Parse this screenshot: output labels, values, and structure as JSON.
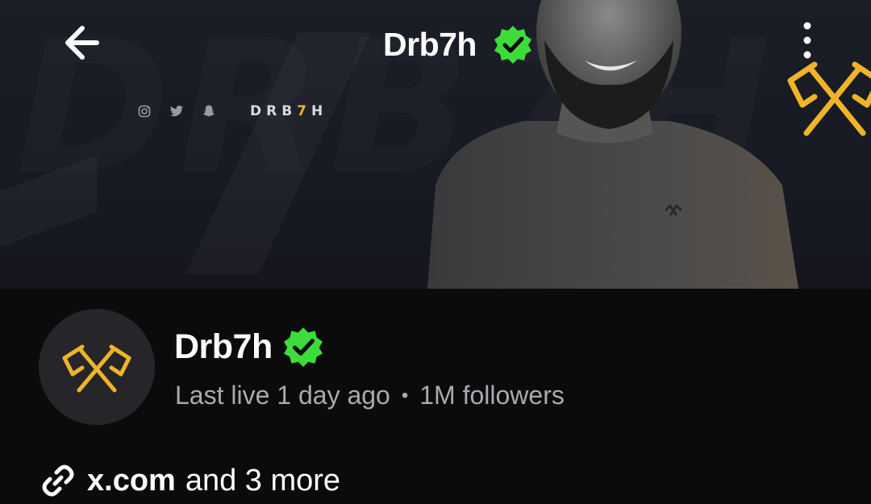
{
  "header": {
    "title": "Drb7h",
    "back_icon": "arrow-left-icon",
    "verified_icon": "verified-check-icon",
    "more_icon": "more-vertical-icon"
  },
  "banner": {
    "brand_prefix": "DRB",
    "brand_seven": "7",
    "brand_suffix": "H",
    "social_icons": [
      "instagram-icon",
      "twitter-icon",
      "snapchat-icon"
    ],
    "accent_color": "#f0b429"
  },
  "profile": {
    "name": "Drb7h",
    "last_live": "Last live 1 day ago",
    "separator": "•",
    "followers": "1M followers",
    "verified_color": "#3ddc3a"
  },
  "links": {
    "primary": "x.com",
    "more": "and 3 more"
  }
}
